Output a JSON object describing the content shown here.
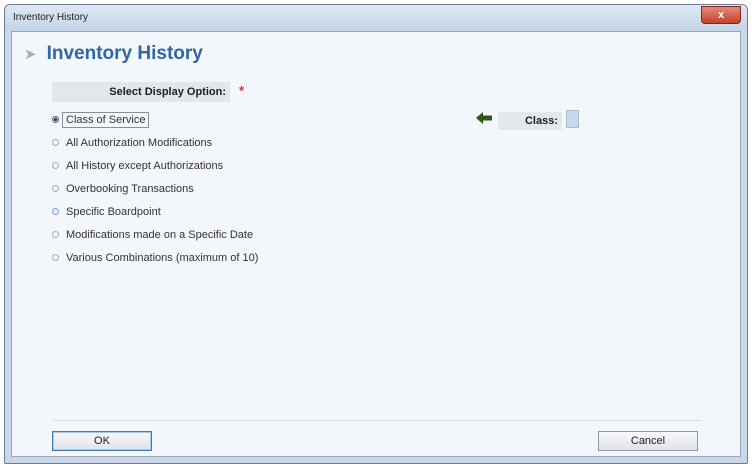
{
  "window": {
    "title": "Inventory History",
    "close_label": "x"
  },
  "heading": {
    "text": "Inventory History"
  },
  "select": {
    "label": "Select Display Option:",
    "required_mark": "*"
  },
  "options": [
    {
      "label": "Class of Service",
      "selected": true
    },
    {
      "label": "All Authorization Modifications",
      "selected": false
    },
    {
      "label": "All History except Authorizations",
      "selected": false
    },
    {
      "label": "Overbooking Transactions",
      "selected": false
    },
    {
      "label": "Specific Boardpoint",
      "selected": false
    },
    {
      "label": "Modifications made on a Specific Date",
      "selected": false
    },
    {
      "label": "Various Combinations (maximum of 10)",
      "selected": false
    }
  ],
  "class_field": {
    "label": "Class:",
    "value": ""
  },
  "buttons": {
    "ok_label": "OK",
    "cancel_label": "Cancel"
  },
  "colors": {
    "heading": "#2f66a7",
    "required": "#d9302a",
    "arrow": "#2d5a12"
  }
}
